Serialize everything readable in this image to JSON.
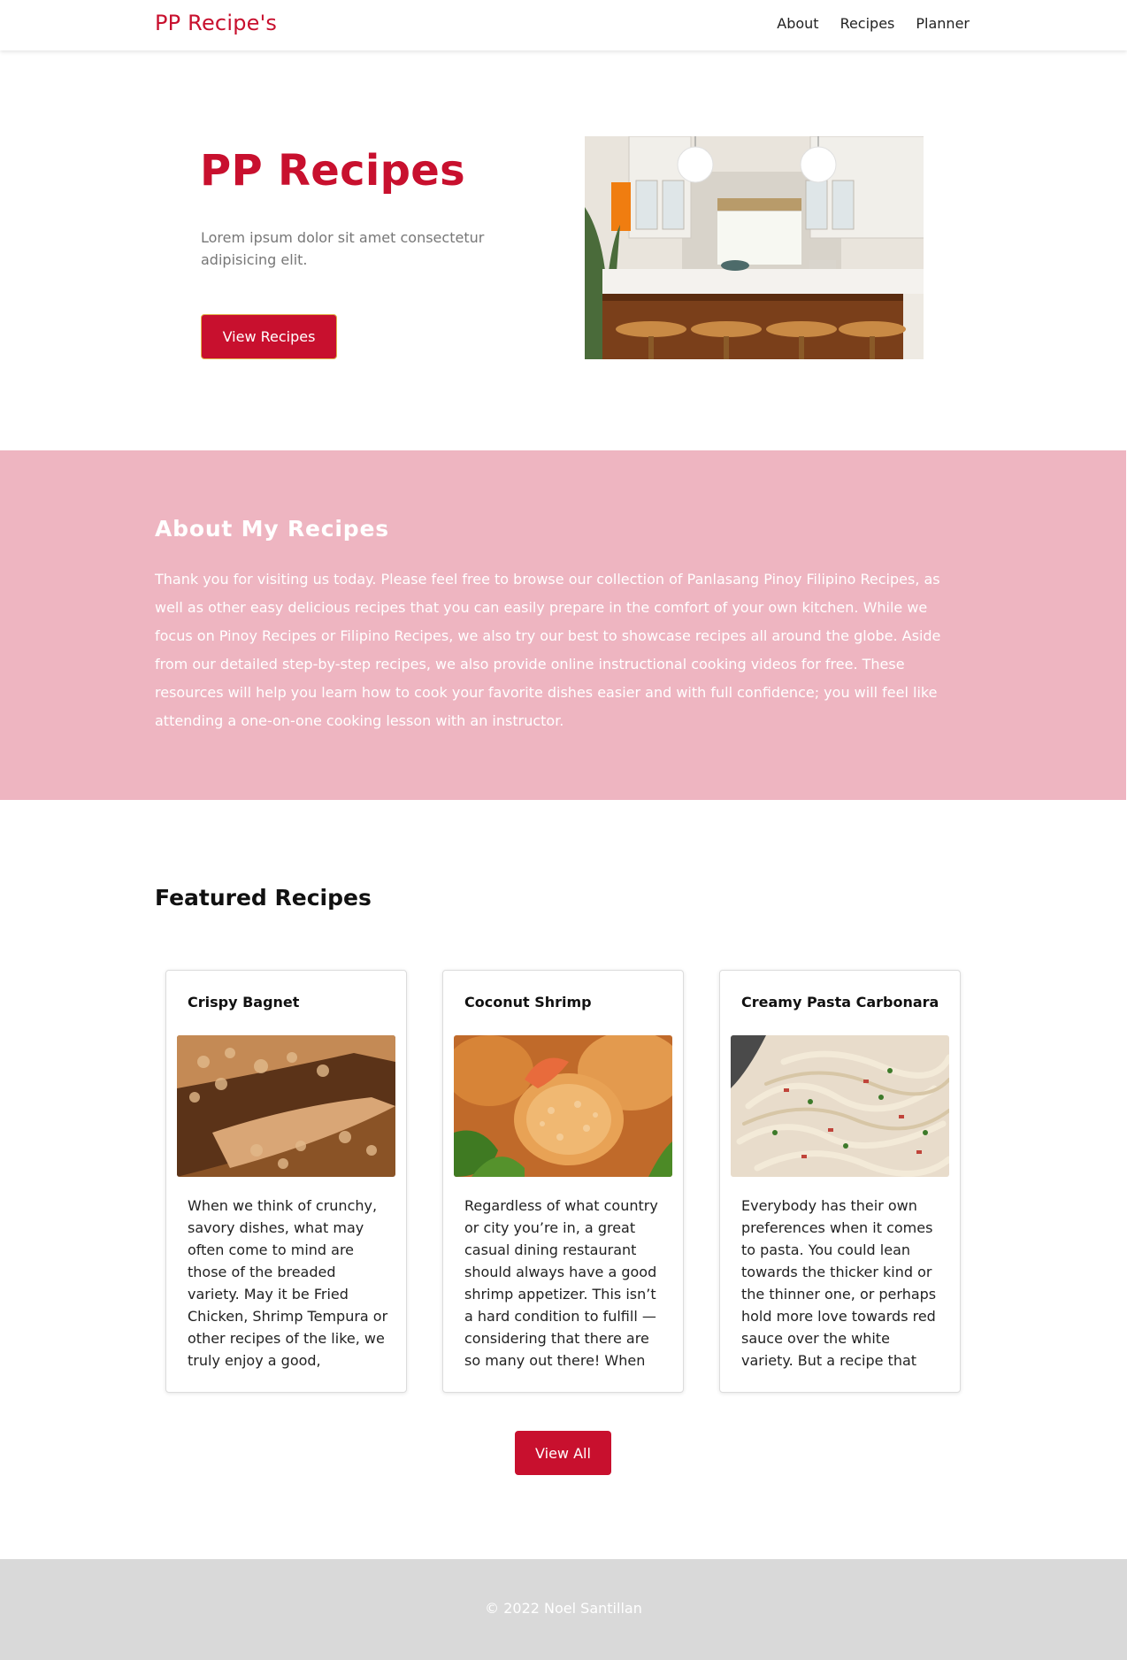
{
  "nav": {
    "brand": "PP Recipe's",
    "links": [
      "About",
      "Recipes",
      "Planner"
    ]
  },
  "hero": {
    "title": "PP Recipes",
    "text": "Lorem ipsum dolor sit amet consectetur adipisicing elit.",
    "button_label": "View Recipes",
    "image_icon": "kitchen-photo"
  },
  "about": {
    "title": "About My Recipes",
    "text": "Thank you for visiting us today. Please feel free to browse our collection of Panlasang Pinoy Filipino Recipes, as well as other easy delicious recipes that you can easily prepare in the comfort of your own kitchen. While we focus on Pinoy Recipes or Filipino Recipes, we also try our best to showcase recipes all around the globe. Aside from our detailed step-by-step recipes, we also provide online instructional cooking videos for free. These resources will help you learn how to cook your favorite dishes easier and with full confidence; you will feel like attending a one-on-one cooking lesson with an instructor."
  },
  "featured": {
    "title": "Featured Recipes",
    "cards": [
      {
        "title": "Crispy Bagnet",
        "text": "When we think of crunchy, savory dishes, what may often come to mind are those of the breaded variety. May it be Fried Chicken, Shrimp Tempura or other recipes of the like, we truly enjoy a good,",
        "image_icon": "crispy-bagnet-photo"
      },
      {
        "title": "Coconut Shrimp",
        "text": "Regardless of what country or city you’re in, a great casual dining restaurant should always have a good shrimp appetizer. This isn’t a hard condition to fulfill — considering that there are so many out there! When",
        "image_icon": "coconut-shrimp-photo"
      },
      {
        "title": "Creamy Pasta Carbonara",
        "text": "Everybody has their own preferences when it comes to pasta. You could lean towards the thicker kind or the thinner one, or perhaps hold more love towards red sauce over the white variety. But a recipe that",
        "image_icon": "pasta-carbonara-photo"
      }
    ],
    "button_label": "View All"
  },
  "footer": {
    "text": "© 2022 Noel Santillan"
  },
  "colors": {
    "accent": "#c8102e",
    "about_bg": "#eeb5c1",
    "footer_bg": "#d9d9d9"
  }
}
